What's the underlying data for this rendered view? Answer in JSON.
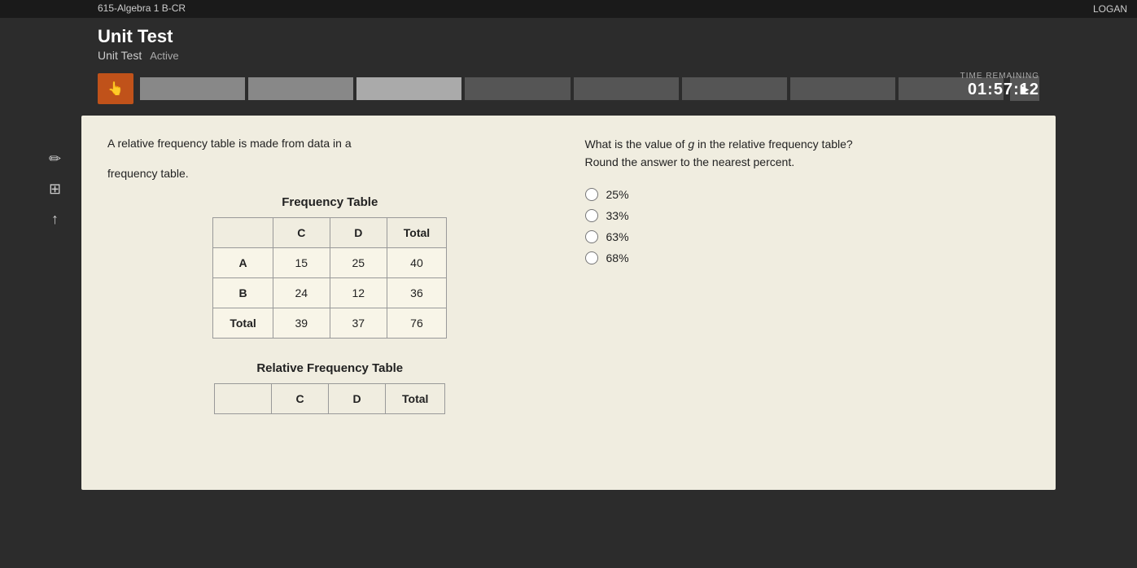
{
  "topBar": {
    "courseTitle": "615-Algebra 1 B-CR",
    "userName": "LOGAN"
  },
  "header": {
    "title": "Unit Test",
    "subtitle": "Unit Test",
    "status": "Active"
  },
  "toolbar": {
    "btnHandLabel": "✋",
    "btnPlayLabel": "▶",
    "timeLabel": "TIME REMAINING",
    "timeValue": "01:57:12"
  },
  "leftSidebar": {
    "icons": [
      {
        "name": "pencil-icon",
        "symbol": "✏"
      },
      {
        "name": "grid-icon",
        "symbol": "⊞"
      },
      {
        "name": "arrow-up-icon",
        "symbol": "↑"
      }
    ]
  },
  "question": {
    "leftText1": "A relative frequency table is made from data in a",
    "leftText2": "frequency table.",
    "frequencyTableTitle": "Frequency Table",
    "frequencyTable": {
      "headers": [
        "",
        "C",
        "D",
        "Total"
      ],
      "rows": [
        [
          "A",
          "15",
          "25",
          "40"
        ],
        [
          "B",
          "24",
          "12",
          "36"
        ],
        [
          "Total",
          "39",
          "37",
          "76"
        ]
      ]
    },
    "relativeFrequencyTableTitle": "Relative Frequency Table",
    "relativeTable": {
      "headers": [
        "",
        "C",
        "D",
        "Total"
      ]
    },
    "rightText": "What is the value of g in the relative frequency table?\nRound the answer to the nearest percent.",
    "answerOptions": [
      {
        "id": "opt1",
        "label": "25%"
      },
      {
        "id": "opt2",
        "label": "33%"
      },
      {
        "id": "opt3",
        "label": "63%"
      },
      {
        "id": "opt4",
        "label": "68%"
      }
    ]
  }
}
